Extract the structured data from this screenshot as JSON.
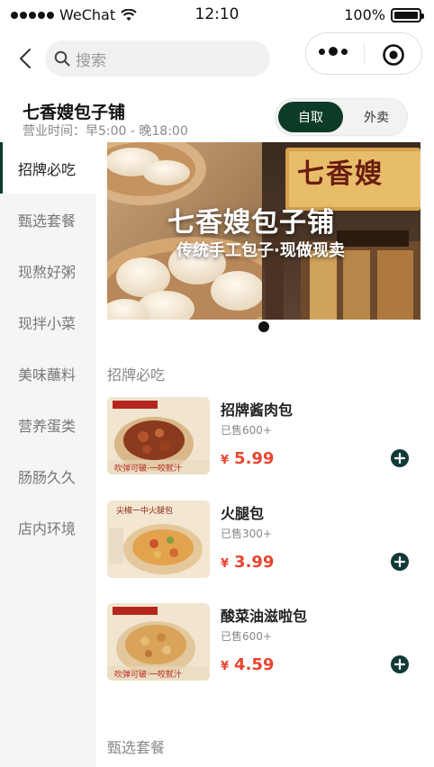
{
  "status_bar": {
    "carrier": "WeChat",
    "time": "12:10",
    "battery": "100%"
  },
  "search": {
    "placeholder": "搜索"
  },
  "shop": {
    "name": "七香嫂包子铺",
    "hours": "营业时间：早5:00 - 晚18:00",
    "modes": [
      "自取",
      "外卖"
    ],
    "active_mode": "自取"
  },
  "banner": {
    "title": "七香嫂包子铺",
    "subtitle": "传统手工包子·现做现卖",
    "sign": "七香嫂"
  },
  "categories": [
    "招牌必吃",
    "甄选套餐",
    "现熬好粥",
    "现拌小菜",
    "美味蘸料",
    "营养蛋类",
    "肠肠久久",
    "店内环境"
  ],
  "active_category": "招牌必吃",
  "sections": [
    {
      "title": "招牌必吃",
      "products": [
        {
          "name": "招牌酱肉包",
          "sold": "已售600+",
          "currency": "¥",
          "price": "5.99",
          "thumb_caption": "吹弹可破·一咬就汁"
        },
        {
          "name": "火腿包",
          "sold": "已售300+",
          "currency": "¥",
          "price": "3.99",
          "thumb_caption": "尖椒一中火腿包"
        },
        {
          "name": "酸菜油滋啦包",
          "sold": "已售600+",
          "currency": "¥",
          "price": "4.59",
          "thumb_caption": "吹弹可破·一咬就汁"
        }
      ]
    },
    {
      "title": "甄选套餐",
      "products": []
    }
  ],
  "colors": {
    "brand": "#0c3b26",
    "price": "#e8452f",
    "add_button": "#0f3a38"
  }
}
